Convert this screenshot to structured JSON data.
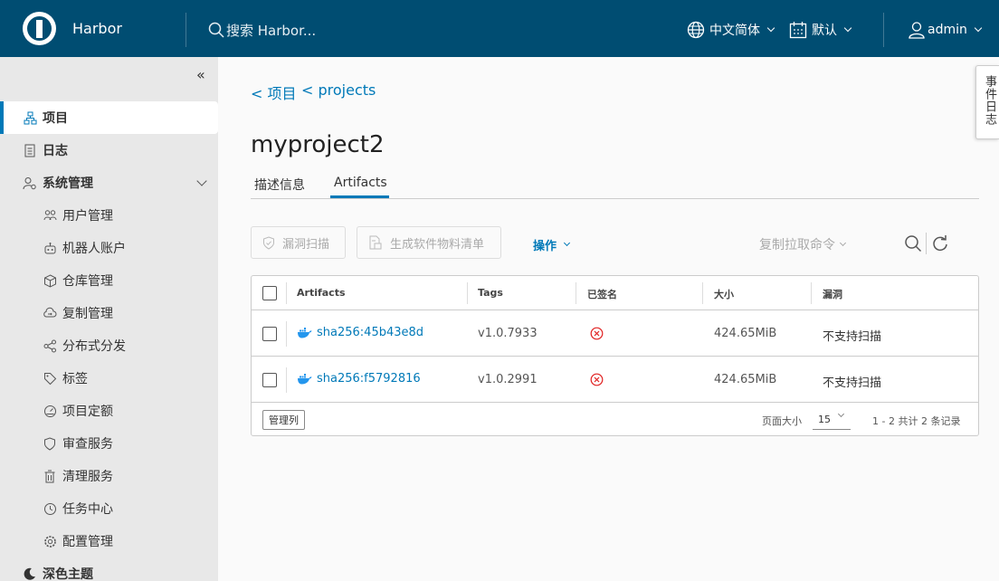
{
  "header": {
    "app_name": "Harbor",
    "search_placeholder": "搜索 Harbor...",
    "language": "中文简体",
    "calendar": "默认",
    "user": "admin"
  },
  "sidebar": {
    "items": [
      {
        "label": "项目",
        "icon": "project-icon",
        "active": true
      },
      {
        "label": "日志",
        "icon": "log-icon"
      },
      {
        "label": "系统管理",
        "icon": "admin-icon"
      }
    ],
    "sub_items": [
      {
        "label": "用户管理",
        "icon": "users-icon"
      },
      {
        "label": "机器人账户",
        "icon": "robot-icon"
      },
      {
        "label": "仓库管理",
        "icon": "registry-icon"
      },
      {
        "label": "复制管理",
        "icon": "replication-icon"
      },
      {
        "label": "分布式分发",
        "icon": "distribution-icon"
      },
      {
        "label": "标签",
        "icon": "tag-icon"
      },
      {
        "label": "项目定额",
        "icon": "quota-icon"
      },
      {
        "label": "审查服务",
        "icon": "shield-icon"
      },
      {
        "label": "清理服务",
        "icon": "trash-icon"
      },
      {
        "label": "任务中心",
        "icon": "job-icon"
      },
      {
        "label": "配置管理",
        "icon": "settings-icon"
      }
    ],
    "theme": "深色主题"
  },
  "breadcrumb": [
    "< 项目",
    "< projects"
  ],
  "page_title": "myproject2",
  "tabs": [
    "描述信息",
    "Artifacts"
  ],
  "toolbar": {
    "scan": "漏洞扫描",
    "sbom": "生成软件物料清单",
    "actions": "操作",
    "pull_command": "复制拉取命令"
  },
  "table": {
    "columns": [
      "Artifacts",
      "Tags",
      "已签名",
      "大小",
      "漏洞"
    ],
    "rows": [
      {
        "digest": "sha256:45b43e8d",
        "tag": "v1.0.7933",
        "signed": "no",
        "size": "424.65MiB",
        "vuln": "不支持扫描"
      },
      {
        "digest": "sha256:f5792816",
        "tag": "v1.0.2991",
        "signed": "no",
        "size": "424.65MiB",
        "vuln": "不支持扫描"
      }
    ],
    "footer": {
      "manage_columns": "管理列",
      "page_size_label": "页面大小",
      "page_size": "15",
      "summary": "1 - 2 共计 2 条记录"
    }
  },
  "event_log": "事件日志",
  "colors": {
    "header": "#004d72",
    "accent": "#0079b8",
    "error": "#e02020"
  }
}
